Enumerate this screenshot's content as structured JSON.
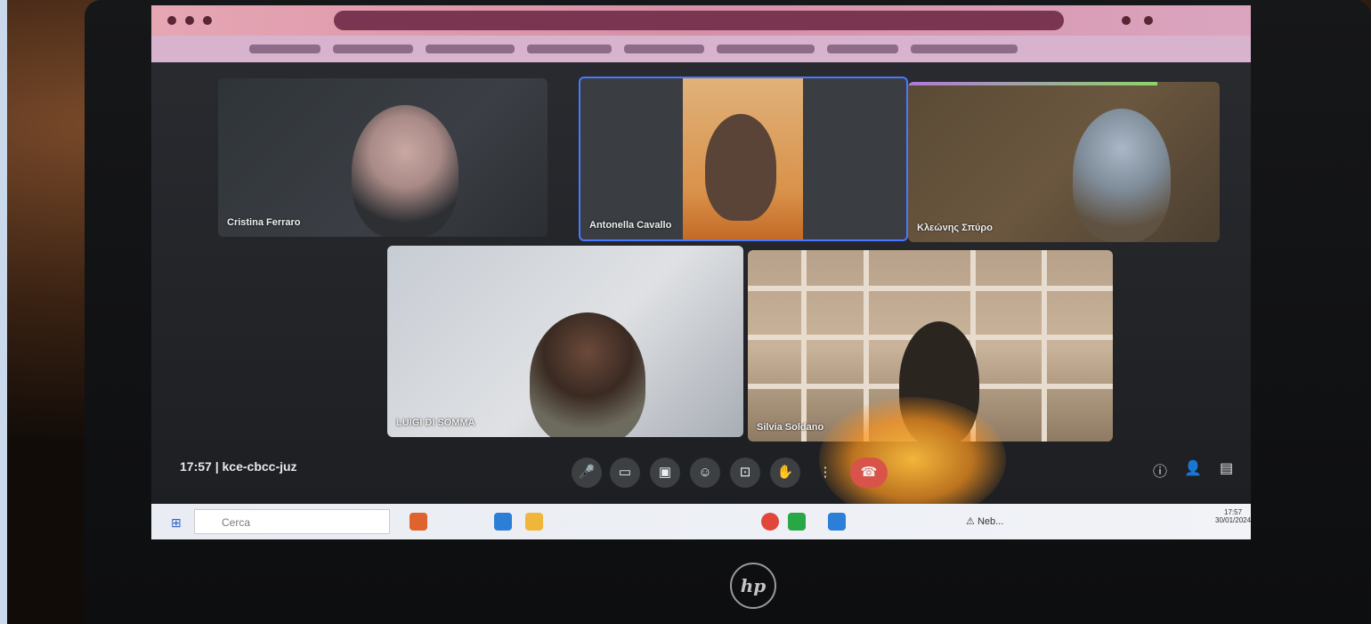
{
  "meeting": {
    "time": "17:57",
    "separator": "|",
    "code": "kce-cbcc-juz"
  },
  "participants": [
    {
      "name": "Cristina Ferraro"
    },
    {
      "name": "Antonella Cavallo"
    },
    {
      "name": "Κλεώνης Σπύρο"
    },
    {
      "name": "LUIGI DI SOMMA"
    },
    {
      "name": "Silvia Soldano"
    }
  ],
  "taskbar": {
    "search_placeholder": "Cerca",
    "clock_time": "17:57",
    "clock_date": "30/01/2024",
    "weather": "Neb..."
  },
  "controls": {
    "mic_icon": "mic-icon",
    "camera_icon": "camera-icon",
    "captions_icon": "captions-icon",
    "emoji_icon": "emoji-icon",
    "present_icon": "present-icon",
    "hand_icon": "raise-hand-icon",
    "more_icon": "more-icon",
    "end_icon": "end-call-icon"
  },
  "brand": {
    "laptop_logo": "hp"
  },
  "colors": {
    "active_speaker_border": "#4a78ff",
    "end_call": "#d9534a"
  }
}
